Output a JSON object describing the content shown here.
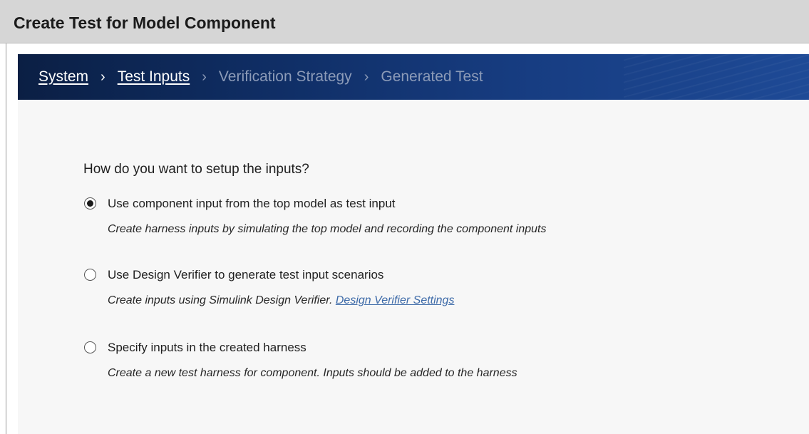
{
  "window": {
    "title": "Create Test for Model Component"
  },
  "breadcrumb": {
    "steps": [
      {
        "label": "System",
        "state": "completed"
      },
      {
        "label": "Test Inputs",
        "state": "current"
      },
      {
        "label": "Verification Strategy",
        "state": "upcoming"
      },
      {
        "label": "Generated Test",
        "state": "upcoming"
      }
    ],
    "separator": "›"
  },
  "main": {
    "question": "How do you want to setup the inputs?",
    "selected_option": "use-component-input",
    "options": [
      {
        "id": "use-component-input",
        "label": "Use component input from the top model as test input",
        "description": "Create harness inputs by simulating the top model and recording the component inputs",
        "checked": true
      },
      {
        "id": "use-design-verifier",
        "label": "Use Design Verifier to generate test input scenarios",
        "description": "Create inputs using Simulink Design Verifier.",
        "link": "Design Verifier Settings",
        "checked": false
      },
      {
        "id": "specify-in-harness",
        "label": "Specify inputs in the created harness",
        "description": "Create a new test harness for component. Inputs should be added to the harness",
        "checked": false
      }
    ]
  },
  "colors": {
    "titlebar_bg": "#d6d6d6",
    "header_dark": "#0b1f44",
    "header_light": "#1e4a96",
    "crumb_active": "#ffffff",
    "crumb_inactive": "#8c9bb8",
    "content_bg": "#f7f7f7",
    "link": "#3d6aa8"
  },
  "icons": {
    "radio_checked": "radio-checked-icon",
    "radio_unchecked": "radio-unchecked-icon",
    "separator": "chevron-right-icon"
  }
}
